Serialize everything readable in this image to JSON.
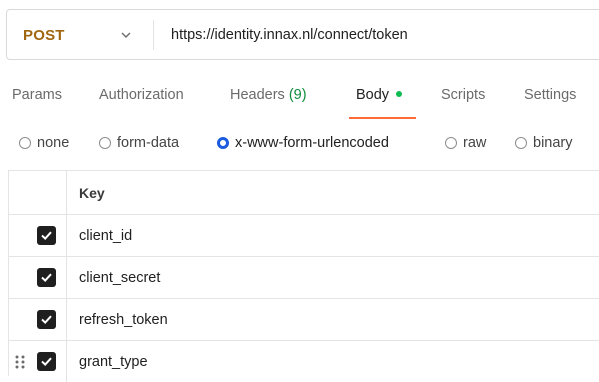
{
  "request": {
    "method": "POST",
    "url": "https://identity.innax.nl/connect/token"
  },
  "tabs": [
    {
      "label": "Params"
    },
    {
      "label": "Authorization"
    },
    {
      "label": "Headers",
      "count": "(9)"
    },
    {
      "label": "Body"
    },
    {
      "label": "Scripts"
    },
    {
      "label": "Settings"
    }
  ],
  "body_types": [
    {
      "label": "none",
      "checked": false
    },
    {
      "label": "form-data",
      "checked": false
    },
    {
      "label": "x-www-form-urlencoded",
      "checked": true
    },
    {
      "label": "raw",
      "checked": false
    },
    {
      "label": "binary",
      "checked": false
    }
  ],
  "table": {
    "header_key": "Key",
    "rows": [
      {
        "key": "client_id",
        "checked": true
      },
      {
        "key": "client_secret",
        "checked": true
      },
      {
        "key": "refresh_token",
        "checked": true
      },
      {
        "key": "grant_type",
        "checked": true
      }
    ]
  },
  "colors": {
    "method": "#a16610",
    "active_tab_underline": "#ff6c37",
    "body_dot": "#0cbb52",
    "radio_selected": "#1a5be0"
  }
}
